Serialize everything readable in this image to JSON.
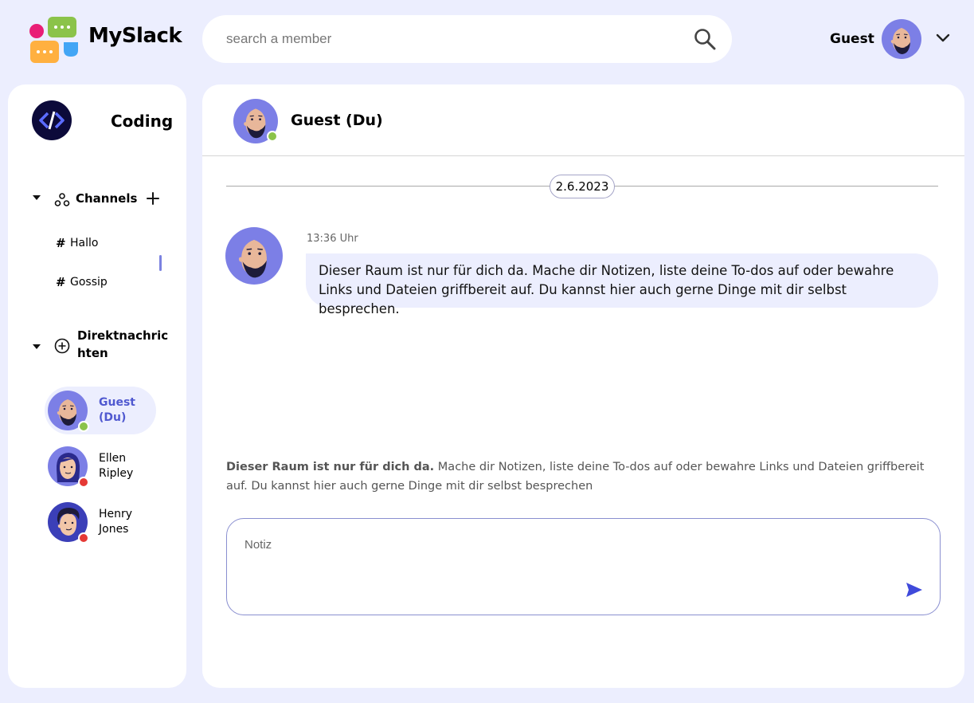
{
  "app": {
    "brand": "MySlack"
  },
  "search": {
    "placeholder": "search a member"
  },
  "user": {
    "name": "Guest"
  },
  "workspace": {
    "name": "Coding"
  },
  "channels": {
    "label": "Channels",
    "items": [
      {
        "label": "Hallo"
      },
      {
        "label": "Gossip"
      }
    ]
  },
  "direct_messages": {
    "label": "Direktnachric\nhten",
    "items": [
      {
        "label": "Guest (Du)",
        "status": "online",
        "status_color": "#8bc34a"
      },
      {
        "label": "Ellen Ripley",
        "status": "offline",
        "status_color": "#e53935"
      },
      {
        "label": "Henry Jones",
        "status": "offline",
        "status_color": "#e53935"
      }
    ]
  },
  "chat": {
    "title": "Guest (Du)",
    "date": "2.6.2023",
    "messages": [
      {
        "time": "13:36 Uhr",
        "text": "Dieser Raum ist nur für dich da. Mache dir Notizen, liste deine To-dos auf oder bewahre Links und Dateien griffbereit auf. Du kannst hier auch gerne Dinge mit dir selbst besprechen."
      }
    ],
    "info_bold": "Dieser Raum ist nur für dich da.",
    "info_rest": " Mache dir Notizen, liste deine To-dos auf oder bewahre Links und Dateien griffbereit auf. Du kannst hier auch gerne Dinge mit dir selbst besprechen",
    "composer_placeholder": "Notiz"
  },
  "colors": {
    "background": "#eceefe",
    "accent": "#5059d0",
    "online": "#8bc34a",
    "offline": "#e53935"
  }
}
